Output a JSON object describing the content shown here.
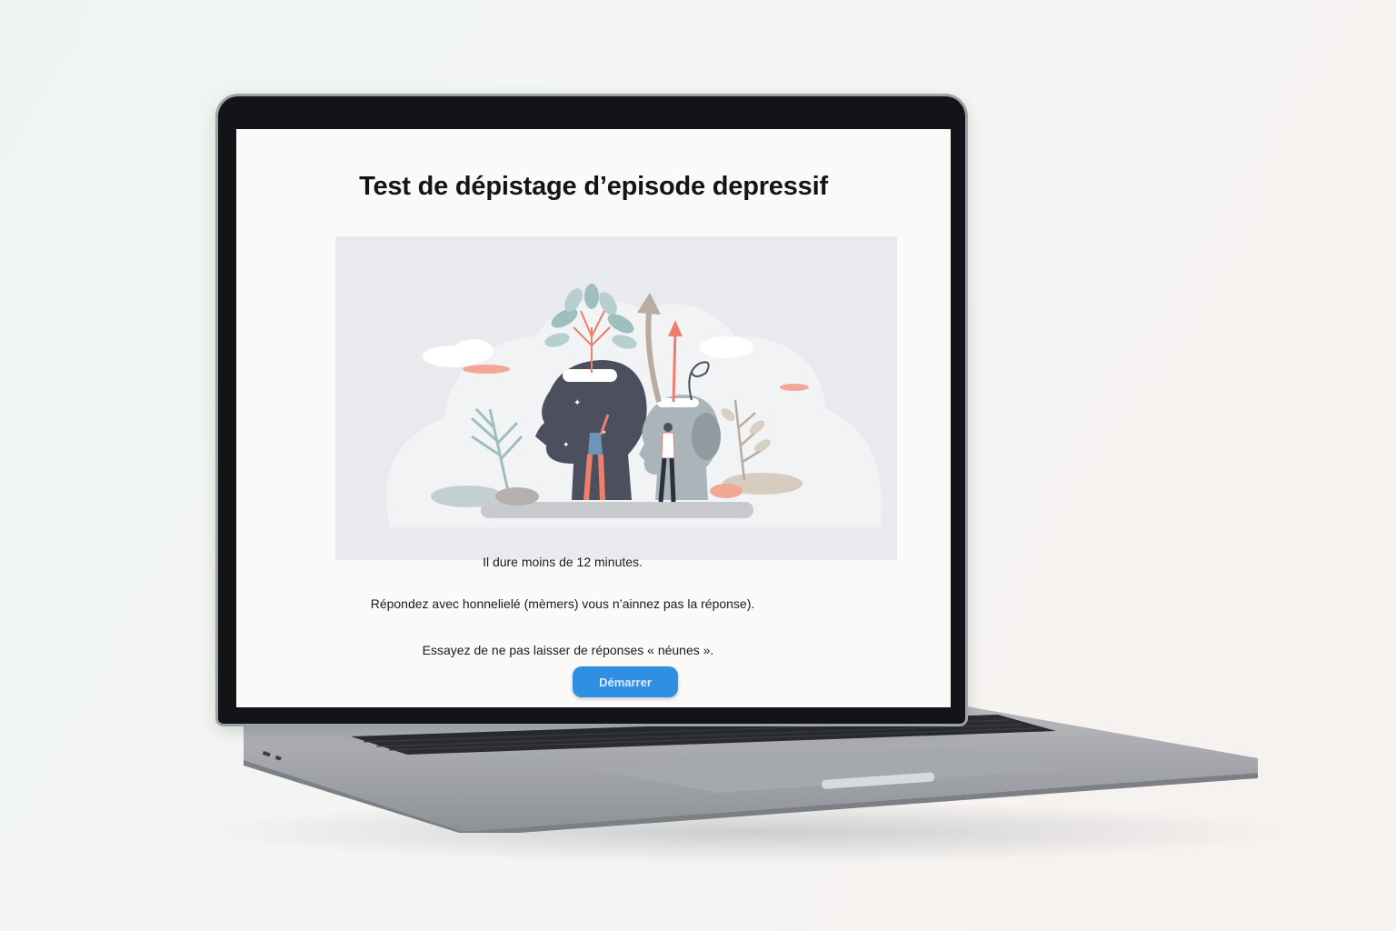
{
  "page": {
    "title": "Test de dépistage d’episode depressif",
    "lines": [
      "Il dure moins de 12 minutes.",
      "Répondez avec honnelielé (mèmers) vous n’ainnez pas la réponse).",
      "Essayez de ne pas laisser de réponses « néunes »."
    ],
    "start_button_label": "Démarrer"
  },
  "icons": [
    "plant-head-icon",
    "arrow-up-icon",
    "person-icon"
  ],
  "colors": {
    "accent_blue": "#2f8fe3",
    "illustration_dark": "#4b4f5e",
    "illustration_light": "#a9b4bb",
    "illustration_coral": "#ee7f6d",
    "leaf_teal": "#9fbfbe"
  }
}
